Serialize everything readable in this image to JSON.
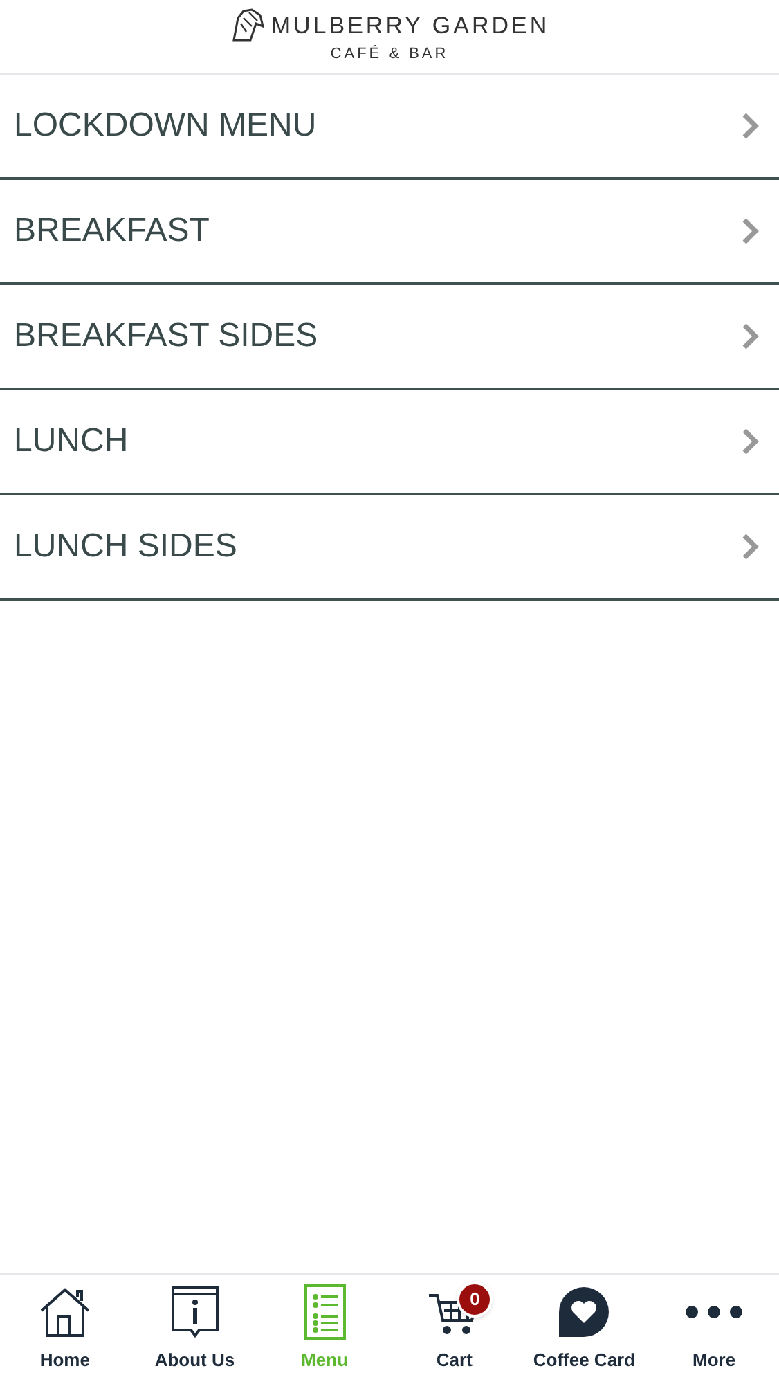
{
  "header": {
    "brand": "MULBERRY GARDEN",
    "subtitle": "CAFÉ & BAR"
  },
  "menu_items": [
    {
      "label": "LOCKDOWN MENU"
    },
    {
      "label": "BREAKFAST"
    },
    {
      "label": "BREAKFAST SIDES"
    },
    {
      "label": "LUNCH"
    },
    {
      "label": "LUNCH SIDES"
    }
  ],
  "tabs": [
    {
      "kind": "home",
      "label": "Home",
      "selected": false
    },
    {
      "kind": "info",
      "label": "About Us",
      "selected": false
    },
    {
      "kind": "menu",
      "label": "Menu",
      "selected": true
    },
    {
      "kind": "cart",
      "label": "Cart",
      "selected": false,
      "badge": "0"
    },
    {
      "kind": "heart",
      "label": "Coffee Card",
      "selected": false
    },
    {
      "kind": "more",
      "label": "More",
      "selected": false
    }
  ]
}
